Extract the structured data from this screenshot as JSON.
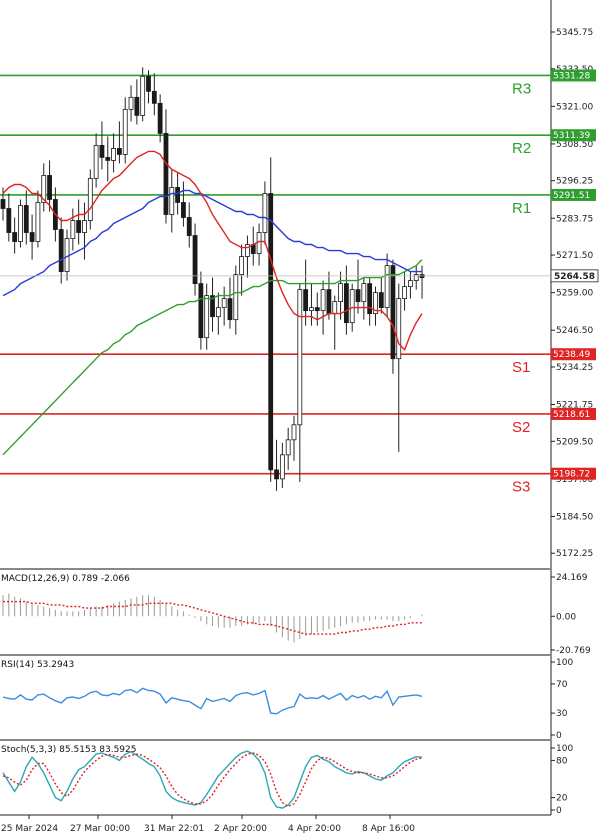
{
  "chart_data": [
    {
      "type": "candlestick",
      "price_ticks": [
        "5345.75",
        "5333.50",
        "5321.00",
        "5308.50",
        "5296.25",
        "5283.75",
        "5271.50",
        "5259.00",
        "5246.50",
        "5234.25",
        "5221.75",
        "5209.50",
        "5197.00",
        "5184.50",
        "5172.25"
      ],
      "current_price": "5264.58",
      "levels": [
        {
          "name": "R3",
          "value": "5331.28",
          "color": "#2e9e2e"
        },
        {
          "name": "R2",
          "value": "5311.39",
          "color": "#2e9e2e"
        },
        {
          "name": "R1",
          "value": "5291.51",
          "color": "#2e9e2e"
        },
        {
          "name": "S1",
          "value": "5238.49",
          "color": "#e02424"
        },
        {
          "name": "S2",
          "value": "5218.61",
          "color": "#e02424"
        },
        {
          "name": "S3",
          "value": "5198.72",
          "color": "#e02424"
        }
      ],
      "x_labels": [
        "25 Mar 2024",
        "27 Mar 00:00",
        "31 Mar 22:01",
        "2 Apr 20:00",
        "4 Apr 20:00",
        "8 Apr 16:00"
      ],
      "candles": [
        [
          5290,
          5294,
          5283,
          5287
        ],
        [
          5287,
          5292,
          5276,
          5279
        ],
        [
          5279,
          5284,
          5272,
          5276
        ],
        [
          5276,
          5290,
          5274,
          5288
        ],
        [
          5288,
          5293,
          5275,
          5279
        ],
        [
          5279,
          5285,
          5270,
          5276
        ],
        [
          5276,
          5293,
          5274,
          5289
        ],
        [
          5289,
          5302,
          5286,
          5298
        ],
        [
          5298,
          5303,
          5286,
          5290
        ],
        [
          5290,
          5294,
          5276,
          5280
        ],
        [
          5280,
          5284,
          5262,
          5266
        ],
        [
          5266,
          5280,
          5263,
          5277
        ],
        [
          5277,
          5287,
          5273,
          5283
        ],
        [
          5283,
          5290,
          5275,
          5279
        ],
        [
          5279,
          5289,
          5270,
          5283
        ],
        [
          5283,
          5300,
          5280,
          5297
        ],
        [
          5297,
          5312,
          5294,
          5308
        ],
        [
          5308,
          5316,
          5300,
          5304
        ],
        [
          5304,
          5311,
          5296,
          5303
        ],
        [
          5303,
          5312,
          5299,
          5307
        ],
        [
          5307,
          5316,
          5302,
          5305
        ],
        [
          5305,
          5324,
          5302,
          5320
        ],
        [
          5320,
          5328,
          5316,
          5324
        ],
        [
          5324,
          5330,
          5315,
          5318
        ],
        [
          5318,
          5334,
          5316,
          5331
        ],
        [
          5331,
          5333,
          5322,
          5326
        ],
        [
          5326,
          5332,
          5318,
          5322
        ],
        [
          5322,
          5325,
          5309,
          5312
        ],
        [
          5312,
          5320,
          5282,
          5285
        ],
        [
          5285,
          5300,
          5279,
          5294
        ],
        [
          5294,
          5299,
          5285,
          5289
        ],
        [
          5289,
          5296,
          5281,
          5284
        ],
        [
          5284,
          5289,
          5274,
          5278
        ],
        [
          5278,
          5282,
          5258,
          5262
        ],
        [
          5262,
          5266,
          5240,
          5244
        ],
        [
          5244,
          5262,
          5240,
          5258
        ],
        [
          5258,
          5264,
          5246,
          5251
        ],
        [
          5251,
          5259,
          5245,
          5254
        ],
        [
          5254,
          5261,
          5248,
          5257
        ],
        [
          5257,
          5264,
          5247,
          5250
        ],
        [
          5250,
          5268,
          5245,
          5265
        ],
        [
          5265,
          5275,
          5258,
          5271
        ],
        [
          5271,
          5278,
          5264,
          5275
        ],
        [
          5275,
          5281,
          5268,
          5272
        ],
        [
          5272,
          5282,
          5268,
          5279
        ],
        [
          5279,
          5296,
          5275,
          5292
        ],
        [
          5292,
          5304,
          5196,
          5200
        ],
        [
          5200,
          5210,
          5193,
          5197
        ],
        [
          5197,
          5209,
          5194,
          5205
        ],
        [
          5205,
          5214,
          5200,
          5210
        ],
        [
          5210,
          5218,
          5203,
          5215
        ],
        [
          5215,
          5262,
          5196,
          5260
        ],
        [
          5260,
          5270,
          5248,
          5253
        ],
        [
          5253,
          5262,
          5248,
          5254
        ],
        [
          5254,
          5259,
          5248,
          5253
        ],
        [
          5253,
          5263,
          5245,
          5260
        ],
        [
          5260,
          5266,
          5250,
          5252
        ],
        [
          5252,
          5258,
          5240,
          5256
        ],
        [
          5256,
          5266,
          5250,
          5262
        ],
        [
          5262,
          5268,
          5245,
          5249
        ],
        [
          5249,
          5262,
          5246,
          5260
        ],
        [
          5260,
          5270,
          5252,
          5256
        ],
        [
          5256,
          5264,
          5250,
          5262
        ],
        [
          5262,
          5264,
          5248,
          5252
        ],
        [
          5252,
          5261,
          5248,
          5259
        ],
        [
          5259,
          5264,
          5252,
          5254
        ],
        [
          5254,
          5272,
          5251,
          5268
        ],
        [
          5268,
          5270,
          5232,
          5237
        ],
        [
          5237,
          5262,
          5206,
          5257
        ],
        [
          5257,
          5266,
          5253,
          5261
        ],
        [
          5261,
          5266,
          5257,
          5263
        ],
        [
          5263,
          5268,
          5260,
          5265
        ],
        [
          5265,
          5268,
          5257,
          5264
        ]
      ],
      "ma_red": [
        5292,
        5294,
        5295,
        5295,
        5294,
        5292,
        5292,
        5290,
        5288,
        5285,
        5283,
        5283,
        5284,
        5285,
        5285,
        5287,
        5290,
        5293,
        5295,
        5297,
        5298,
        5300,
        5302,
        5304,
        5305,
        5306,
        5306,
        5305,
        5302,
        5300,
        5299,
        5298,
        5297,
        5295,
        5292,
        5289,
        5285,
        5282,
        5279,
        5276,
        5275,
        5274,
        5274,
        5275,
        5276,
        5276,
        5270,
        5264,
        5259,
        5255,
        5252,
        5251,
        5251,
        5251,
        5250,
        5251,
        5252,
        5252,
        5252,
        5253,
        5254,
        5254,
        5254,
        5254,
        5253,
        5253,
        5251,
        5248,
        5242,
        5240,
        5245,
        5249,
        5252
      ],
      "ma_blue": [
        5258,
        5259,
        5260,
        5262,
        5263,
        5264,
        5265,
        5266,
        5268,
        5269,
        5270,
        5271,
        5272,
        5273,
        5274,
        5276,
        5277,
        5279,
        5280,
        5282,
        5283,
        5284,
        5285,
        5286,
        5287,
        5289,
        5290,
        5291,
        5291,
        5292,
        5292,
        5293,
        5293,
        5292,
        5292,
        5291,
        5290,
        5289,
        5288,
        5287,
        5286,
        5286,
        5285,
        5285,
        5284,
        5284,
        5283,
        5281,
        5279,
        5277,
        5276,
        5276,
        5275,
        5275,
        5274,
        5274,
        5273,
        5273,
        5273,
        5272,
        5272,
        5272,
        5271,
        5271,
        5270,
        5270,
        5270,
        5269,
        5268,
        5267,
        5266,
        5266,
        5266
      ],
      "ma_green": [
        5205,
        5207,
        5209,
        5211,
        5213,
        5215,
        5217,
        5219,
        5221,
        5223,
        5225,
        5227,
        5229,
        5231,
        5233,
        5235,
        5237,
        5239,
        5240,
        5242,
        5243,
        5245,
        5246,
        5248,
        5249,
        5250,
        5251,
        5252,
        5253,
        5254,
        5255,
        5255,
        5256,
        5256,
        5257,
        5257,
        5257,
        5258,
        5258,
        5258,
        5259,
        5259,
        5260,
        5261,
        5261,
        5262,
        5263,
        5263,
        5263,
        5262,
        5262,
        5262,
        5262,
        5262,
        5262,
        5262,
        5262,
        5262,
        5263,
        5263,
        5263,
        5263,
        5264,
        5264,
        5264,
        5264,
        5265,
        5265,
        5265,
        5266,
        5267,
        5268,
        5270
      ]
    },
    {
      "type": "bar",
      "title": "MACD(12,26,9) 0.789 -2.066",
      "ticks": [
        "24.169",
        "0.00",
        "-20.769"
      ],
      "ylim": [
        -20.769,
        24.169
      ],
      "histogram": [
        13,
        14,
        12,
        11,
        9,
        8,
        7,
        6,
        5,
        4,
        3,
        3,
        3,
        3,
        4,
        5,
        6,
        6,
        7,
        8,
        9,
        10,
        11,
        12,
        13,
        13,
        12,
        10,
        8,
        6,
        4,
        3,
        1,
        -1,
        -3,
        -5,
        -6,
        -7,
        -7,
        -7,
        -6,
        -6,
        -5,
        -5,
        -4,
        -3,
        -6,
        -10,
        -13,
        -15,
        -16,
        -14,
        -12,
        -11,
        -10,
        -9,
        -8,
        -7,
        -6,
        -5,
        -4,
        -4,
        -3,
        -3,
        -2,
        -2,
        -2,
        -3,
        -3,
        -2,
        -1,
        0,
        1
      ],
      "signal": [
        9,
        9,
        9,
        9,
        9,
        8,
        8,
        8,
        7,
        7,
        7,
        6,
        6,
        6,
        5,
        5,
        5,
        5,
        6,
        6,
        6,
        6,
        7,
        7,
        7,
        8,
        8,
        8,
        8,
        8,
        7,
        7,
        6,
        5,
        4,
        3,
        2,
        1,
        0,
        -1,
        -2,
        -3,
        -4,
        -4,
        -5,
        -5,
        -5,
        -6,
        -7,
        -8,
        -9,
        -10,
        -11,
        -11,
        -11,
        -11,
        -11,
        -11,
        -10,
        -10,
        -9,
        -9,
        -8,
        -8,
        -7,
        -7,
        -6,
        -6,
        -5,
        -5,
        -4,
        -4,
        -4
      ]
    },
    {
      "type": "line",
      "title": "RSI(14) 53.2943",
      "ticks": [
        "100",
        "70",
        "30",
        "0"
      ],
      "ylim": [
        0,
        100
      ],
      "values": [
        52,
        50,
        49,
        55,
        49,
        48,
        55,
        56,
        51,
        47,
        44,
        51,
        52,
        50,
        53,
        58,
        60,
        55,
        54,
        57,
        55,
        61,
        62,
        58,
        64,
        61,
        60,
        56,
        44,
        51,
        49,
        47,
        46,
        41,
        36,
        50,
        46,
        48,
        50,
        46,
        54,
        57,
        58,
        55,
        57,
        61,
        30,
        29,
        34,
        37,
        39,
        56,
        50,
        51,
        50,
        54,
        49,
        53,
        57,
        48,
        54,
        51,
        54,
        49,
        53,
        51,
        60,
        41,
        52,
        53,
        54,
        55,
        53
      ]
    },
    {
      "type": "line",
      "title": "Stoch(5,3,3) 85.5153 83.5925",
      "ticks": [
        "100",
        "80",
        "20",
        "0"
      ],
      "ylim": [
        0,
        100
      ],
      "k": [
        60,
        45,
        30,
        45,
        70,
        85,
        75,
        60,
        40,
        20,
        15,
        30,
        50,
        65,
        70,
        80,
        90,
        92,
        88,
        85,
        80,
        90,
        94,
        88,
        82,
        75,
        70,
        55,
        30,
        20,
        15,
        12,
        10,
        8,
        12,
        25,
        40,
        55,
        65,
        75,
        85,
        92,
        95,
        90,
        80,
        60,
        20,
        5,
        3,
        8,
        20,
        45,
        70,
        85,
        88,
        82,
        78,
        70,
        65,
        60,
        58,
        62,
        60,
        55,
        50,
        48,
        55,
        60,
        70,
        78,
        82,
        86,
        85
      ],
      "d": [
        55,
        52,
        45,
        40,
        48,
        65,
        75,
        75,
        60,
        42,
        28,
        22,
        32,
        48,
        62,
        72,
        80,
        87,
        90,
        88,
        85,
        85,
        88,
        90,
        88,
        82,
        76,
        68,
        55,
        38,
        25,
        18,
        13,
        10,
        10,
        15,
        25,
        40,
        53,
        65,
        75,
        84,
        90,
        92,
        88,
        78,
        58,
        30,
        12,
        6,
        10,
        25,
        45,
        67,
        80,
        85,
        83,
        78,
        72,
        66,
        62,
        60,
        60,
        58,
        55,
        52,
        52,
        55,
        62,
        70,
        77,
        82,
        84
      ]
    }
  ]
}
